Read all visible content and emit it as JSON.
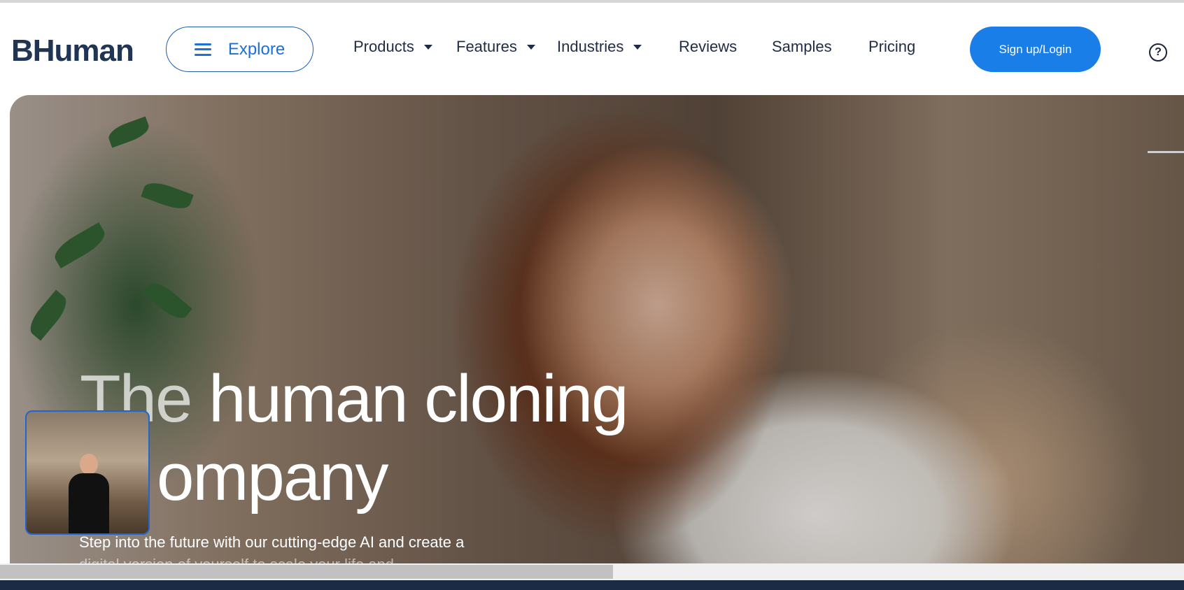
{
  "header": {
    "logo": "BHuman",
    "explore_label": "Explore",
    "nav": [
      {
        "label": "Products",
        "dropdown": true
      },
      {
        "label": "Features",
        "dropdown": true
      },
      {
        "label": "Industries",
        "dropdown": true
      },
      {
        "label": "Reviews",
        "dropdown": false
      },
      {
        "label": "Samples",
        "dropdown": false
      },
      {
        "label": "Pricing",
        "dropdown": false
      }
    ],
    "signup_label": "Sign up/Login",
    "help_glyph": "?"
  },
  "hero": {
    "title_line1_dim": "The",
    "title_line1_rest": " human cloning",
    "title_line2": "ompany",
    "subtitle": "Step into the future with our cutting-edge AI and create a",
    "subtitle_line2": "digital version of yourself to scale your life and"
  },
  "colors": {
    "brand_blue": "#1a7ee8",
    "text_dark": "#1f2c45"
  }
}
